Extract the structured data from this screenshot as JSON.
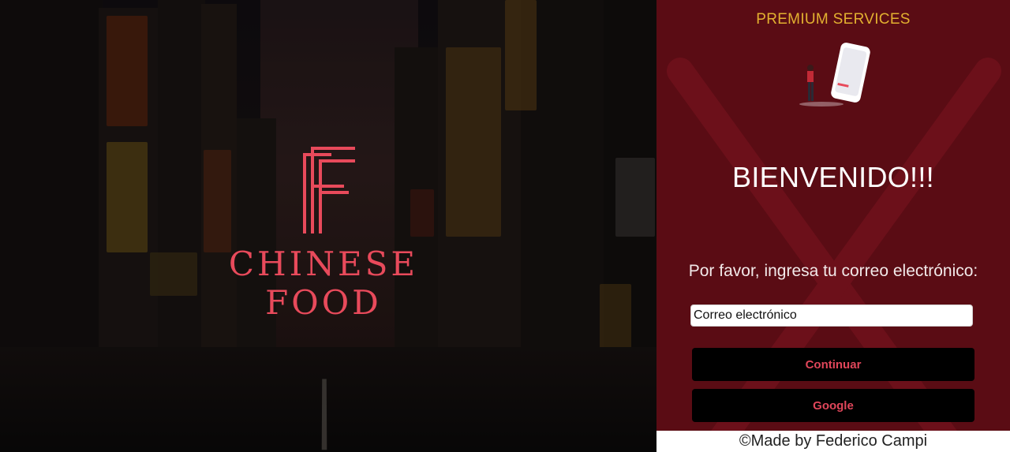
{
  "hero": {
    "brand_text": "CHINESE FOOD",
    "logo_icon": "ff-monogram-icon",
    "background_icon": "city-street-night-photo"
  },
  "panel": {
    "premium_label": "PREMIUM SERVICES",
    "illustration_icon": "person-phone-illustration-icon",
    "welcome_title": "BIENVENIDO!!!",
    "prompt_text": "Por favor, ingresa tu correo electrónico:",
    "email_input": {
      "value": "Correo electrónico",
      "placeholder": "Correo electrónico"
    },
    "continue_label": "Continuar",
    "google_label": "Google"
  },
  "footer": {
    "credit": "©Made by Federico Campi"
  },
  "colors": {
    "panel_bg": "#5a0c14",
    "accent_red": "#e84a5b",
    "premium_gold": "#e2b030",
    "button_bg": "#000000"
  }
}
